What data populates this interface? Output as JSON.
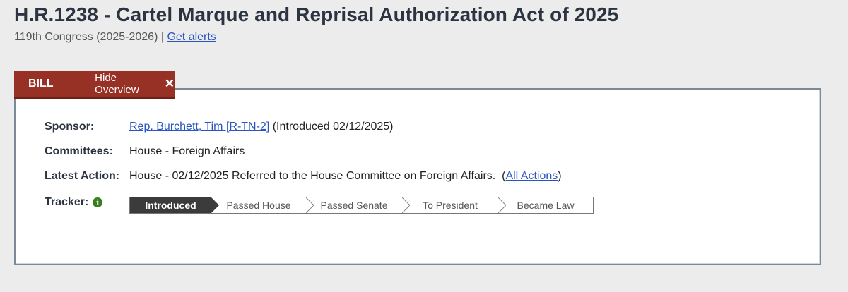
{
  "bill": {
    "title": "H.R.1238 - Cartel Marque and Reprisal Authorization Act of 2025",
    "congress": "119th Congress (2025-2026)",
    "separator": "|",
    "alerts_link": "Get alerts"
  },
  "tabs": {
    "bill_label": "BILL",
    "hide_label": "Hide Overview"
  },
  "overview": {
    "sponsor_label": "Sponsor:",
    "sponsor_link": "Rep. Burchett, Tim [R-TN-2]",
    "sponsor_extra": "(Introduced 02/12/2025)",
    "committees_label": "Committees:",
    "committees_value": "House - Foreign Affairs",
    "latest_label": "Latest Action:",
    "latest_value": "House - 02/12/2025 Referred to the House Committee on Foreign Affairs.",
    "latest_paren_open": "(",
    "all_actions_link": "All Actions",
    "latest_paren_close": ")",
    "tracker_label": "Tracker:"
  },
  "tracker": {
    "steps": [
      "Introduced",
      "Passed House",
      "Passed Senate",
      "To President",
      "Became Law"
    ],
    "current_index": 0
  },
  "colors": {
    "tab_bg": "#973025",
    "link": "#2a55c1",
    "info_icon": "#3a7d1e",
    "tracker_current": "#3b3b3b"
  },
  "icons": {
    "close": "close-icon",
    "info": "info-icon"
  }
}
